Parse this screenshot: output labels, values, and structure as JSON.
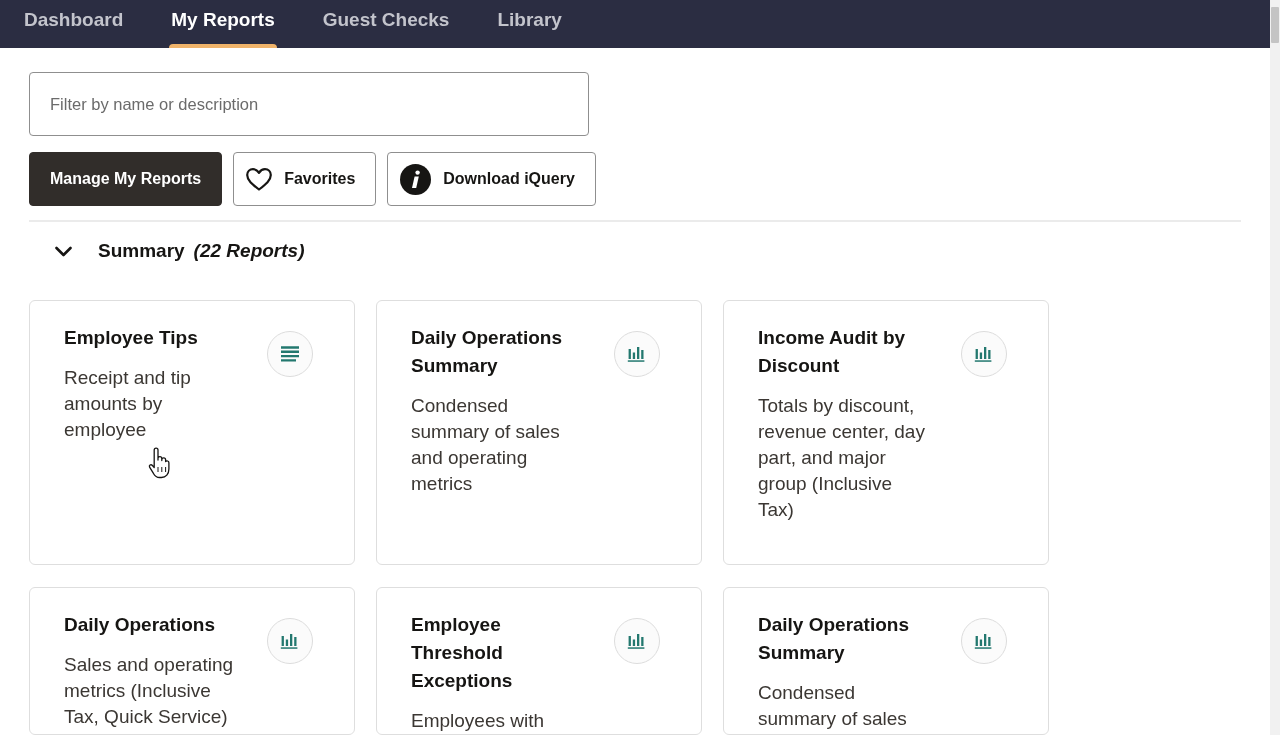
{
  "nav": {
    "tabs": [
      {
        "label": "Dashboard",
        "selected": false
      },
      {
        "label": "My Reports",
        "selected": true
      },
      {
        "label": "Guest Checks",
        "selected": false
      },
      {
        "label": "Library",
        "selected": false
      }
    ]
  },
  "filter": {
    "placeholder": "Filter by name or description"
  },
  "actions": [
    {
      "label": "Manage My Reports",
      "kind": "primary"
    },
    {
      "label": "Favorites",
      "kind": "favorite"
    },
    {
      "label": "Download iQuery",
      "kind": "info"
    }
  ],
  "section": {
    "title": "Summary",
    "count": "(22 Reports)",
    "expanded": true,
    "reports": [
      {
        "title": "Employee Tips",
        "description": "Receipt and tip amounts by employee",
        "kind": "list"
      },
      {
        "title": "Daily Operations Summary",
        "description": "Condensed summary of sales and operating metrics",
        "kind": "chart"
      },
      {
        "title": "Income Audit by Discount",
        "description": "Totals by discount, revenue center, day part, and major group (Inclusive Tax)",
        "kind": "chart"
      },
      {
        "title": "Daily Operations",
        "description": "Sales and operating metrics (Inclusive Tax, Quick Service)",
        "kind": "chart"
      },
      {
        "title": "Employee Threshold Exceptions",
        "description": "Employees with",
        "kind": "chart"
      },
      {
        "title": "Daily Operations Summary",
        "description": "Condensed summary of sales",
        "kind": "chart"
      }
    ]
  }
}
